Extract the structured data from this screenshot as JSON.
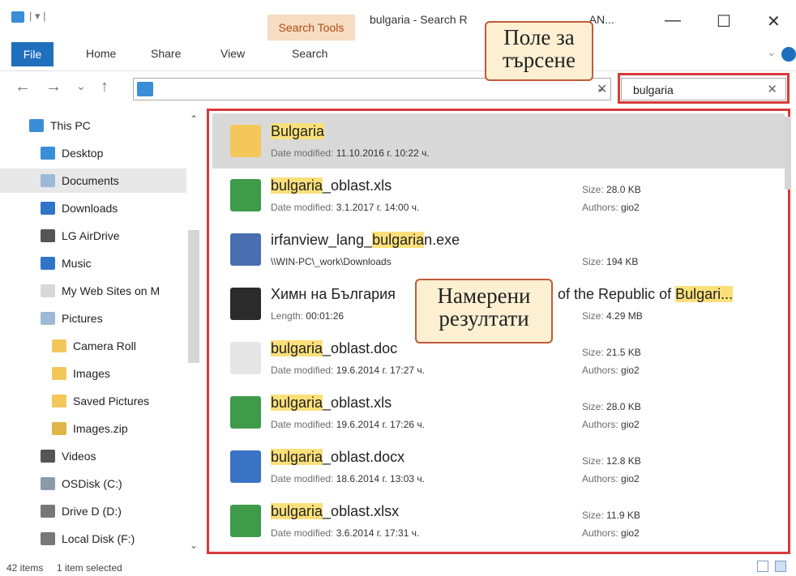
{
  "window": {
    "title": "bulgaria - Search R",
    "title_tail": "AN...",
    "context_tab": "Search Tools",
    "controls": {
      "minimize": "—",
      "maximize": "☐",
      "close": "✕"
    }
  },
  "ribbon": {
    "tabs": [
      "File",
      "Home",
      "Share",
      "View",
      "Search"
    ]
  },
  "address": {
    "path": "",
    "back": "←",
    "forward": "→",
    "recent": "⌄",
    "up": "↑",
    "clear": "✕"
  },
  "search": {
    "value": "bulgaria",
    "clear": "✕"
  },
  "callouts": {
    "search_label": [
      "Поле за",
      "търсене"
    ],
    "results_label": [
      "Намерени",
      "резултати"
    ]
  },
  "nav": {
    "items": [
      {
        "label": "This PC",
        "icon": "computer-icon",
        "color": "#3a8ed8"
      },
      {
        "label": "Desktop",
        "icon": "desktop-icon",
        "color": "#3a8ed8"
      },
      {
        "label": "Documents",
        "icon": "documents-icon",
        "color": "#9cb9d8",
        "selected": true
      },
      {
        "label": "Downloads",
        "icon": "download-icon",
        "color": "#2f74c8"
      },
      {
        "label": "LG AirDrive",
        "icon": "drive-icon",
        "color": "#555555"
      },
      {
        "label": "Music",
        "icon": "music-icon",
        "color": "#2f74c8"
      },
      {
        "label": "My Web Sites on M",
        "icon": "file-icon",
        "color": "#d8d8d8"
      },
      {
        "label": "Pictures",
        "icon": "pictures-icon",
        "color": "#9cb9d8"
      },
      {
        "label": "Camera Roll",
        "icon": "folder-icon",
        "color": "#f3c75a"
      },
      {
        "label": "Images",
        "icon": "folder-icon",
        "color": "#f3c75a"
      },
      {
        "label": "Saved Pictures",
        "icon": "folder-icon",
        "color": "#f3c75a"
      },
      {
        "label": "Images.zip",
        "icon": "zip-folder-icon",
        "color": "#e0b64a"
      },
      {
        "label": "Videos",
        "icon": "videos-icon",
        "color": "#555555"
      },
      {
        "label": "OSDisk (C:)",
        "icon": "disk-icon",
        "color": "#8a9aa8"
      },
      {
        "label": "Drive D (D:)",
        "icon": "disk-icon",
        "color": "#777777"
      },
      {
        "label": "Local Disk (F:)",
        "icon": "disk-icon",
        "color": "#777777"
      }
    ]
  },
  "results": [
    {
      "pre": "",
      "hl": "Bulgaria",
      "post": "",
      "icon": "folder-icon",
      "color": "#f3c75a",
      "meta_label": "Date modified:",
      "meta_value": "11.10.2016 г. 10:22 ч.",
      "selected": true,
      "c2a_label": "",
      "c2a_value": "",
      "c2b_label": "",
      "c2b_value": ""
    },
    {
      "pre": "",
      "hl": "bulgaria",
      "post": "_oblast.xls",
      "icon": "excel-icon",
      "color": "#3f9a4a",
      "meta_label": "Date modified:",
      "meta_value": "3.1.2017 г. 14:00 ч.",
      "c2a_label": "Size:",
      "c2a_value": "28.0 KB",
      "c2b_label": "Authors:",
      "c2b_value": "gio2"
    },
    {
      "pre": "irfanview_lang_",
      "hl": "bulgaria",
      "post": "n.exe",
      "icon": "exe-icon",
      "color": "#4a6fb0",
      "meta_label": "",
      "meta_value": "\\\\WIN-PC\\_work\\Downloads",
      "c2a_label": "",
      "c2a_value": "",
      "c2b_label": "Size:",
      "c2b_value": "194 KB"
    },
    {
      "pre": "Химн на България",
      "hl": "",
      "post": "",
      "tail_pre": "of the Republic of ",
      "tail_hl": "Bulgari...",
      "icon": "video-file-icon",
      "color": "#2b2b2b",
      "meta_label": "Length:",
      "meta_value": "00:01:26",
      "c2a_label": "",
      "c2a_value": "",
      "c2b_label": "Size:",
      "c2b_value": "4.29 MB"
    },
    {
      "pre": "",
      "hl": "bulgaria",
      "post": "_oblast.doc",
      "icon": "doc-icon",
      "color": "#e6e6e6",
      "meta_label": "Date modified:",
      "meta_value": "19.6.2014 г. 17:27 ч.",
      "c2a_label": "Size:",
      "c2a_value": "21.5 KB",
      "c2b_label": "Authors:",
      "c2b_value": "gio2"
    },
    {
      "pre": "",
      "hl": "bulgaria",
      "post": "_oblast.xls",
      "icon": "excel-icon",
      "color": "#3f9a4a",
      "meta_label": "Date modified:",
      "meta_value": "19.6.2014 г. 17:26 ч.",
      "c2a_label": "Size:",
      "c2a_value": "28.0 KB",
      "c2b_label": "Authors:",
      "c2b_value": "gio2"
    },
    {
      "pre": "",
      "hl": "bulgaria",
      "post": "_oblast.docx",
      "icon": "word-icon",
      "color": "#3a72c4",
      "meta_label": "Date modified:",
      "meta_value": "18.6.2014 г. 13:03 ч.",
      "c2a_label": "Size:",
      "c2a_value": "12.8 KB",
      "c2b_label": "Authors:",
      "c2b_value": "gio2"
    },
    {
      "pre": "",
      "hl": "bulgaria",
      "post": "_oblast.xlsx",
      "icon": "excel-icon",
      "color": "#3f9a4a",
      "meta_label": "Date modified:",
      "meta_value": "3.6.2014 г. 17:31 ч.",
      "c2a_label": "Size:",
      "c2a_value": "11.9 KB",
      "c2b_label": "Authors:",
      "c2b_value": "gio2"
    }
  ],
  "status": {
    "count": "42 items",
    "selected": "1 item selected"
  }
}
